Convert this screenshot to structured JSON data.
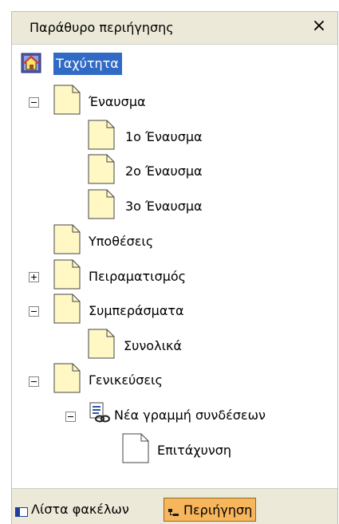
{
  "window": {
    "title": "Παράθυρο περιήγησης",
    "close_label": "×"
  },
  "tree": {
    "root": {
      "label": "Ταχύτητα",
      "icon": "home-icon"
    },
    "nodes": [
      {
        "label": "Έναυσμα",
        "expander": "minus"
      },
      {
        "label": "1ο Έναυσμα"
      },
      {
        "label": "2ο Έναυσμα"
      },
      {
        "label": "3ο Έναυσμα"
      },
      {
        "label": "Υποθέσεις"
      },
      {
        "label": "Πειραματισμός",
        "expander": "plus"
      },
      {
        "label": "Συμπεράσματα",
        "expander": "minus"
      },
      {
        "label": "Συνολικά"
      },
      {
        "label": "Γενικεύσεις",
        "expander": "minus"
      },
      {
        "label": "Νέα γραμμή συνδέσεων",
        "expander": "minus",
        "icon": "link-list-icon"
      },
      {
        "label": "Επιτάχυνση",
        "icon": "white-page-icon"
      }
    ]
  },
  "footer": {
    "tabs": [
      {
        "label": "Λίστα φακέλων",
        "icon": "folder-list-icon",
        "active": false
      },
      {
        "label": "Περιήγηση",
        "icon": "navigation-icon",
        "active": true
      }
    ]
  },
  "colors": {
    "selection": "#316ac5",
    "active_tab": "#f8b65c",
    "panel": "#ece9d8",
    "page_icon": "#fff8c5"
  }
}
